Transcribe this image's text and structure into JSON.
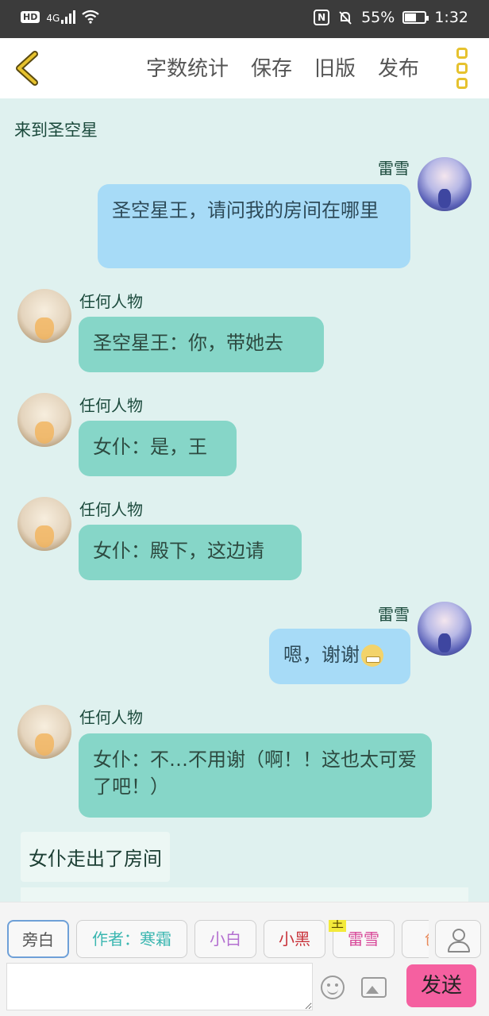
{
  "status_bar": {
    "hd": "HD",
    "network": "4G",
    "battery_percent": "55%",
    "time": "1:32",
    "icons": [
      "signal-icon",
      "wifi-icon",
      "nfc-icon",
      "mute-bell-icon",
      "battery-icon"
    ]
  },
  "toolbar": {
    "back_icon": "chevron-left-icon",
    "items": [
      "字数统计",
      "保存",
      "旧版",
      "发布"
    ],
    "more_icon": "kebab-icon",
    "accent_color": "#e6c22e"
  },
  "chat": {
    "narration_top": "来到圣空星",
    "messages": [
      {
        "side": "right",
        "name": "雷雪",
        "text": "圣空星王，请问我的房间在哪里"
      },
      {
        "side": "left",
        "name": "任何人物",
        "text": "圣空星王：你，带她去"
      },
      {
        "side": "left",
        "name": "任何人物",
        "text": "女仆：是，王"
      },
      {
        "side": "left",
        "name": "任何人物",
        "text": "女仆：殿下，这边请"
      },
      {
        "side": "right",
        "name": "雷雪",
        "text": "嗯，谢谢",
        "emoji": "grin-emoji"
      },
      {
        "side": "left",
        "name": "任何人物",
        "text": "女仆：不…不用谢（啊！！这也太可爱了吧！）"
      }
    ],
    "narration_bottom": "女仆走出了房间"
  },
  "composer": {
    "roles": [
      "旁白",
      "作者：寒霜",
      "小白",
      "小黑",
      "雷雪",
      "创"
    ],
    "role_badge": "主",
    "input_value": "",
    "send_label": "发送",
    "send_color": "#f560a0"
  }
}
